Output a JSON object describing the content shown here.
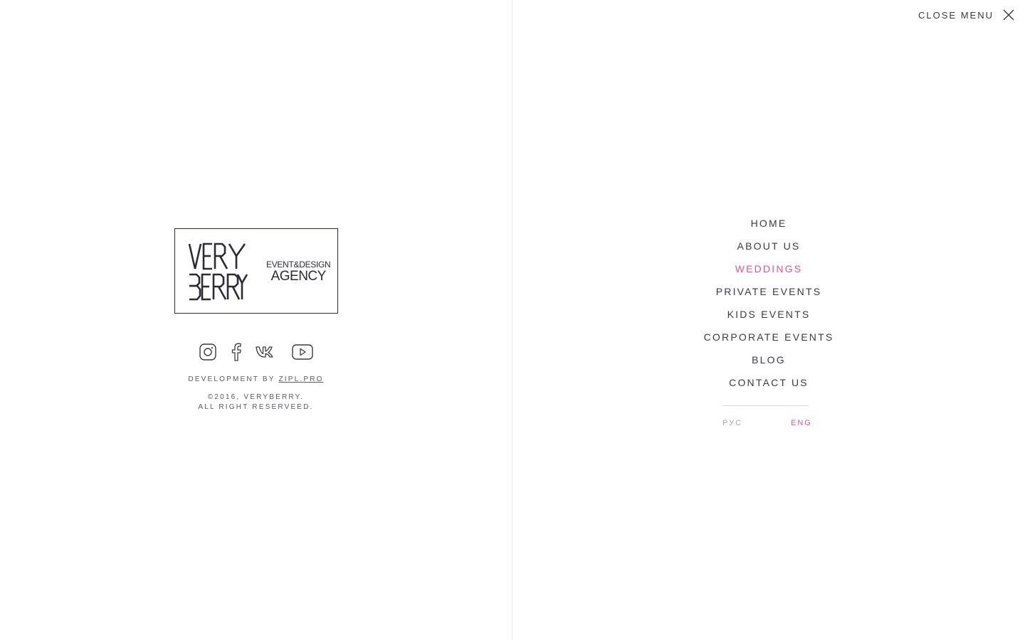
{
  "header": {
    "close_label": "CLOSE MENU",
    "close_icon": "close-icon"
  },
  "brand": {
    "logo_lines": [
      "VERY",
      "BERRY"
    ],
    "tagline_1": "EVENT&DESIGN",
    "tagline_2": "AGENCY"
  },
  "social": [
    {
      "name": "instagram",
      "icon": "instagram-icon"
    },
    {
      "name": "facebook",
      "icon": "facebook-icon"
    },
    {
      "name": "vk",
      "icon": "vk-icon"
    },
    {
      "name": "youtube",
      "icon": "youtube-icon"
    }
  ],
  "footer": {
    "dev_prefix": "DEVELOPMENT BY",
    "dev_link": "ZIPL.PRO",
    "copyright_1": "©2016, VERYBERRY.",
    "copyright_2": "ALL RIGHT RESERVEED."
  },
  "nav": {
    "items": [
      {
        "label": "HOME",
        "active": false
      },
      {
        "label": "ABOUT US",
        "active": false
      },
      {
        "label": "WEDDINGS",
        "active": true
      },
      {
        "label": "PRIVATE EVENTS",
        "active": false
      },
      {
        "label": "KIDS EVENTS",
        "active": false
      },
      {
        "label": "CORPORATE EVENTS",
        "active": false
      },
      {
        "label": "BLOG",
        "active": false
      },
      {
        "label": "CONTACT US",
        "active": false
      }
    ]
  },
  "languages": {
    "ru": "РУС",
    "en": "ENG",
    "selected": "ENG"
  },
  "colors": {
    "accent": "#e8538d",
    "text": "#3a3a44",
    "muted": "#a8a8b0"
  }
}
